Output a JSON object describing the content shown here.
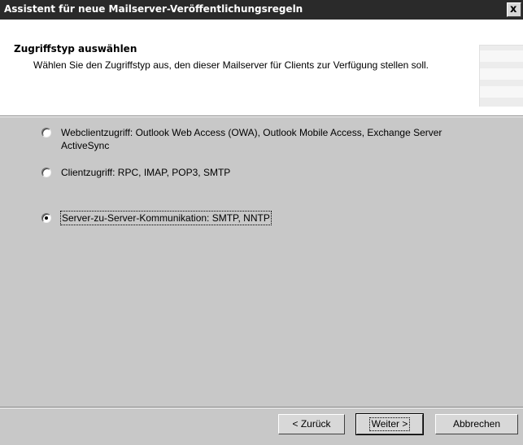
{
  "window": {
    "title": "Assistent für neue Mailserver-Veröffentlichungsregeln",
    "close_label": "x"
  },
  "header": {
    "title": "Zugriffstyp auswählen",
    "subtitle": "Wählen Sie den Zugriffstyp aus, den dieser Mailserver für Clients zur Verfügung stellen soll."
  },
  "options": [
    {
      "label": "Webclientzugriff: Outlook Web Access (OWA), Outlook Mobile Access, Exchange Server ActiveSync",
      "selected": false
    },
    {
      "label": "Clientzugriff: RPC, IMAP, POP3, SMTP",
      "selected": false
    },
    {
      "label": "Server-zu-Server-Kommunikation: SMTP, NNTP",
      "selected": true
    }
  ],
  "buttons": {
    "back": "< Zurück",
    "next": "Weiter >",
    "cancel": "Abbrechen"
  }
}
